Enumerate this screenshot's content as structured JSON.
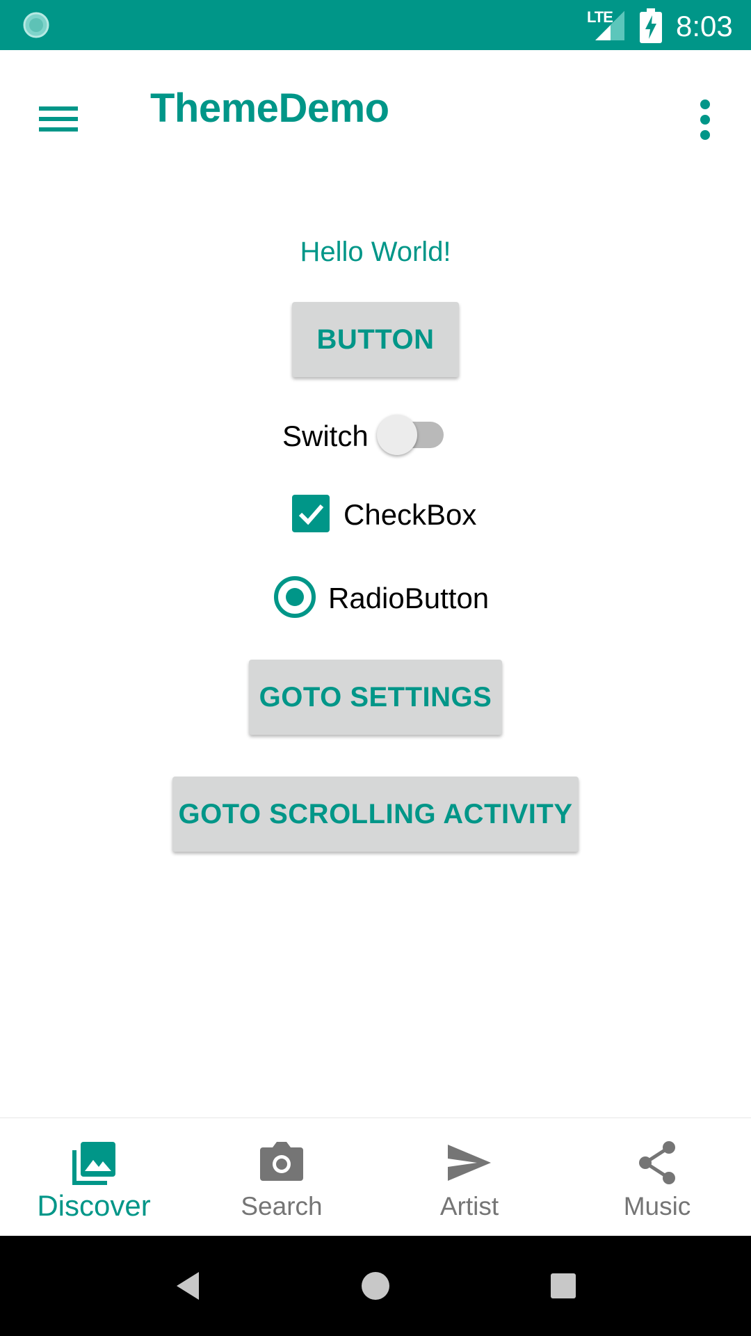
{
  "status_bar": {
    "time": "8:03",
    "network": "LTE",
    "icons": [
      "loading-icon",
      "signal-icon",
      "battery-charging-icon"
    ],
    "color": "#009688"
  },
  "app_bar": {
    "title": "ThemeDemo",
    "icons": [
      "menu-icon",
      "overflow-menu-icon"
    ]
  },
  "content": {
    "greeting": "Hello World!",
    "button_label": "BUTTON",
    "switch_label": "Switch",
    "switch_on": false,
    "checkbox_label": "CheckBox",
    "checkbox_checked": true,
    "radio_label": "RadioButton",
    "radio_selected": true,
    "settings_button_label": "GOTO SETTINGS",
    "scrolling_button_label": "GOTO SCROLLING ACTIVITY"
  },
  "bottom_nav": {
    "items": [
      {
        "label": "Discover",
        "icon": "photo-library-icon",
        "active": true
      },
      {
        "label": "Search",
        "icon": "camera-icon",
        "active": false
      },
      {
        "label": "Artist",
        "icon": "send-icon",
        "active": false
      },
      {
        "label": "Music",
        "icon": "share-icon",
        "active": false
      }
    ]
  },
  "system_nav": {
    "icons": [
      "back-icon",
      "home-icon",
      "recents-icon"
    ]
  },
  "colors": {
    "accent": "#009688",
    "button_bg": "#d6d7d7",
    "inactive": "#757575",
    "text": "#000000"
  }
}
